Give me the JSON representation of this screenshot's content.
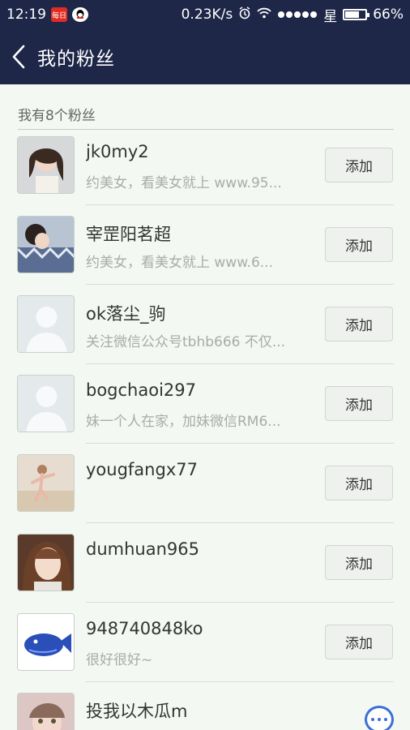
{
  "status_bar": {
    "time": "12:19",
    "app_badge_1": "每日",
    "speed": "0.23K/s",
    "carrier": "星",
    "battery": "66%"
  },
  "header": {
    "title": "我的粉丝"
  },
  "section": {
    "label": "我有8个粉丝"
  },
  "add_label": "添加",
  "fans": [
    {
      "name": "jk0my2",
      "desc": "约美女，看美女就上  www.95...",
      "has_add": true
    },
    {
      "name": "宰罡阳茗超",
      "desc": "约美女，看美女就上   www.6...",
      "has_add": true
    },
    {
      "name": "ok落尘_驹",
      "desc": "关注微信公众号tbhb666 不仅...",
      "has_add": true
    },
    {
      "name": "bogchaoi297",
      "desc": "妹一个人在家，加妹微信RM6...",
      "has_add": true
    },
    {
      "name": "yougfangx77",
      "desc": "",
      "has_add": true
    },
    {
      "name": "dumhuan965",
      "desc": "",
      "has_add": true
    },
    {
      "name": "948740848ko",
      "desc": "很好很好~",
      "has_add": true
    },
    {
      "name": "投我以木瓜m",
      "desc": "",
      "has_add": false
    }
  ]
}
